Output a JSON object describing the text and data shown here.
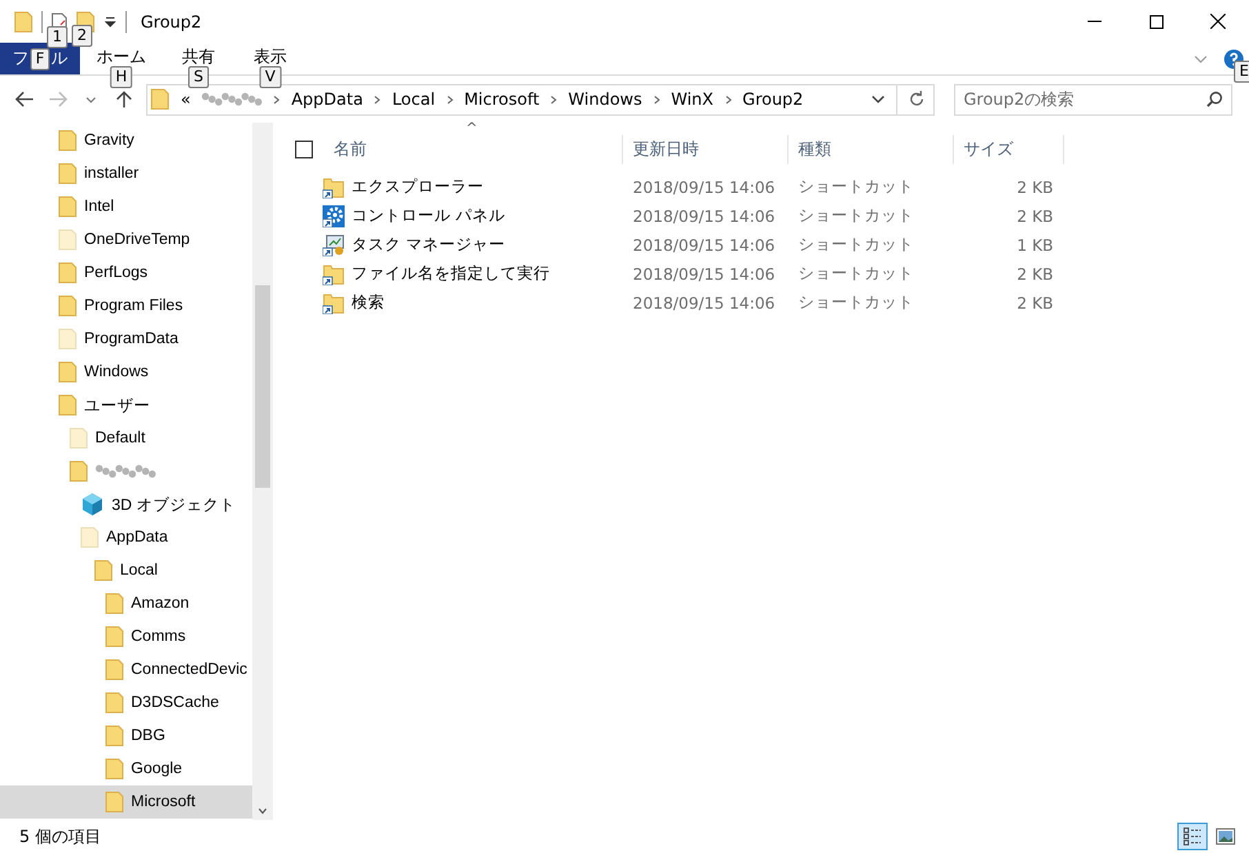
{
  "window": {
    "title": "Group2",
    "quick_access": [
      {
        "kind": "properties",
        "keytip": "1"
      },
      {
        "kind": "new-folder",
        "keytip": "2"
      }
    ]
  },
  "ribbon": {
    "tabs": [
      {
        "label_parts": [
          "フ",
          "ル"
        ],
        "keytip": "F",
        "kind": "file"
      },
      {
        "label": "ホーム",
        "keytip": "H",
        "kind": "tab"
      },
      {
        "label": "共有",
        "keytip": "S",
        "kind": "tab"
      },
      {
        "label": "表示",
        "keytip": "V",
        "kind": "tab"
      }
    ],
    "help_keytip": "E"
  },
  "address": {
    "overflow": "«",
    "crumbs": [
      {
        "kind": "redacted"
      },
      {
        "kind": "text",
        "label": "AppData"
      },
      {
        "kind": "text",
        "label": "Local"
      },
      {
        "kind": "text",
        "label": "Microsoft"
      },
      {
        "kind": "text",
        "label": "Windows"
      },
      {
        "kind": "text",
        "label": "WinX"
      },
      {
        "kind": "text",
        "label": "Group2"
      }
    ]
  },
  "search": {
    "placeholder": "Group2の検索"
  },
  "tree": [
    {
      "label": "Gravity",
      "kind": "folder",
      "selected": false
    },
    {
      "label": "installer",
      "kind": "folder",
      "selected": false
    },
    {
      "label": "Intel",
      "kind": "folder",
      "selected": false
    },
    {
      "label": "OneDriveTemp",
      "kind": "hidden",
      "selected": false
    },
    {
      "label": "PerfLogs",
      "kind": "folder",
      "selected": false
    },
    {
      "label": "Program Files",
      "kind": "folder",
      "selected": false
    },
    {
      "label": "ProgramData",
      "kind": "hidden",
      "selected": false
    },
    {
      "label": "Windows",
      "kind": "folder",
      "selected": false
    },
    {
      "label": "ユーザー",
      "kind": "folder",
      "selected": false,
      "children": [
        {
          "label": "Default",
          "kind": "hidden",
          "selected": false
        },
        {
          "kind": "redacted",
          "selected": false,
          "children": [
            {
              "label": "3D オブジェクト",
              "kind": "cube",
              "selected": false
            },
            {
              "label": "AppData",
              "kind": "hidden",
              "selected": false,
              "children": [
                {
                  "label": "Local",
                  "kind": "folder",
                  "selected": false,
                  "children": [
                    {
                      "label": "Amazon",
                      "kind": "folder",
                      "selected": false
                    },
                    {
                      "label": "Comms",
                      "kind": "folder",
                      "selected": false
                    },
                    {
                      "label": "ConnectedDevic",
                      "kind": "folder",
                      "selected": false
                    },
                    {
                      "label": "D3DSCache",
                      "kind": "folder",
                      "selected": false
                    },
                    {
                      "label": "DBG",
                      "kind": "folder",
                      "selected": false
                    },
                    {
                      "label": "Google",
                      "kind": "folder",
                      "selected": false
                    },
                    {
                      "label": "Microsoft",
                      "kind": "folder",
                      "selected": true
                    }
                  ]
                }
              ]
            }
          ]
        }
      ]
    }
  ],
  "table": {
    "sort_indicator": "^",
    "select_all": {
      "checked": false
    },
    "columns": [
      "名前",
      "更新日時",
      "種類",
      "サイズ"
    ],
    "rows": [
      {
        "kind": "folder-shortcut",
        "cells": [
          "エクスプローラー",
          "2018/09/15 14:06",
          "ショートカット",
          "2 KB"
        ]
      },
      {
        "kind": "gear-shortcut",
        "cells": [
          "コントロール パネル",
          "2018/09/15 14:06",
          "ショートカット",
          "2 KB"
        ]
      },
      {
        "kind": "monitor-shortcut",
        "cells": [
          "タスク マネージャー",
          "2018/09/15 14:06",
          "ショートカット",
          "1 KB"
        ]
      },
      {
        "kind": "folder-shortcut",
        "cells": [
          "ファイル名を指定して実行",
          "2018/09/15 14:06",
          "ショートカット",
          "2 KB"
        ]
      },
      {
        "kind": "folder-shortcut",
        "cells": [
          "検索",
          "2018/09/15 14:06",
          "ショートカット",
          "2 KB"
        ]
      }
    ]
  },
  "status_bar": {
    "text": "5 個の項目",
    "views": [
      {
        "kind": "details",
        "selected": true
      },
      {
        "kind": "tiles",
        "selected": false
      }
    ]
  }
}
